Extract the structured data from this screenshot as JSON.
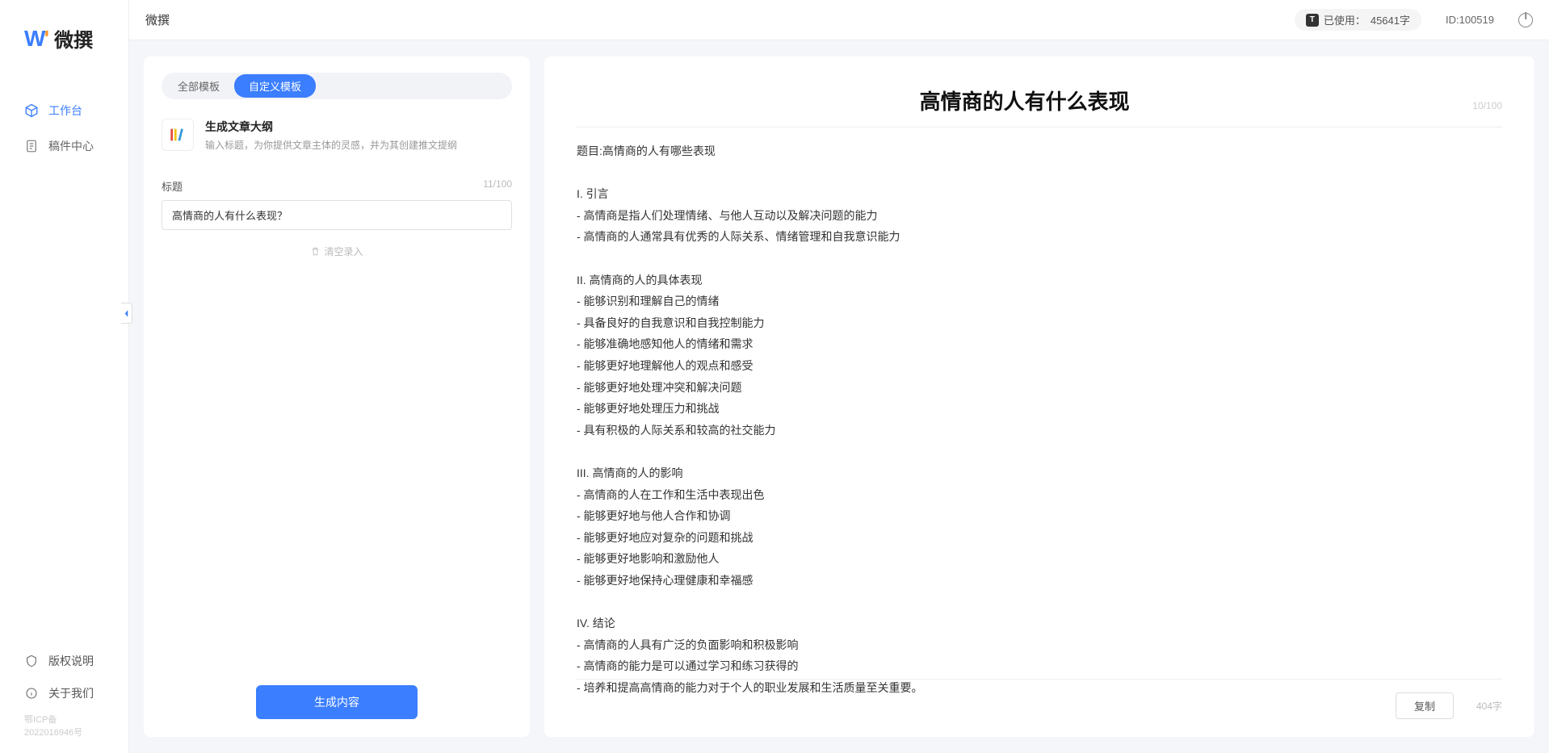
{
  "app_name": "微撰",
  "topbar": {
    "title": "微撰",
    "usage_prefix": "已使用：",
    "usage_value": "45641字",
    "id_label": "ID:100519"
  },
  "sidebar": {
    "logo_text": "微撰",
    "nav": [
      {
        "label": "工作台",
        "active": true
      },
      {
        "label": "稿件中心",
        "active": false
      }
    ],
    "bottom": [
      {
        "label": "版权说明"
      },
      {
        "label": "关于我们"
      }
    ],
    "icp": "鄂ICP备2022016946号"
  },
  "left_panel": {
    "tabs": [
      {
        "label": "全部模板",
        "active": false
      },
      {
        "label": "自定义模板",
        "active": true
      }
    ],
    "template": {
      "title": "生成文章大纲",
      "desc": "输入标题，为你提供文章主体的灵感，并为其创建推文提纲"
    },
    "field_label": "标题",
    "field_count": "11/100",
    "input_value": "高情商的人有什么表现？",
    "clear_label": "清空录入",
    "generate_label": "生成内容"
  },
  "right_panel": {
    "title": "高情商的人有什么表现",
    "title_count": "10/100",
    "body": "题目:高情商的人有哪些表现\n\nI. 引言\n- 高情商是指人们处理情绪、与他人互动以及解决问题的能力\n- 高情商的人通常具有优秀的人际关系、情绪管理和自我意识能力\n\nII. 高情商的人的具体表现\n- 能够识别和理解自己的情绪\n- 具备良好的自我意识和自我控制能力\n- 能够准确地感知他人的情绪和需求\n- 能够更好地理解他人的观点和感受\n- 能够更好地处理冲突和解决问题\n- 能够更好地处理压力和挑战\n- 具有积极的人际关系和较高的社交能力\n\nIII. 高情商的人的影响\n- 高情商的人在工作和生活中表现出色\n- 能够更好地与他人合作和协调\n- 能够更好地应对复杂的问题和挑战\n- 能够更好地影响和激励他人\n- 能够更好地保持心理健康和幸福感\n\nIV. 结论\n- 高情商的人具有广泛的负面影响和积极影响\n- 高情商的能力是可以通过学习和练习获得的\n- 培养和提高高情商的能力对于个人的职业发展和生活质量至关重要。",
    "copy_label": "复制",
    "word_count": "404字"
  }
}
